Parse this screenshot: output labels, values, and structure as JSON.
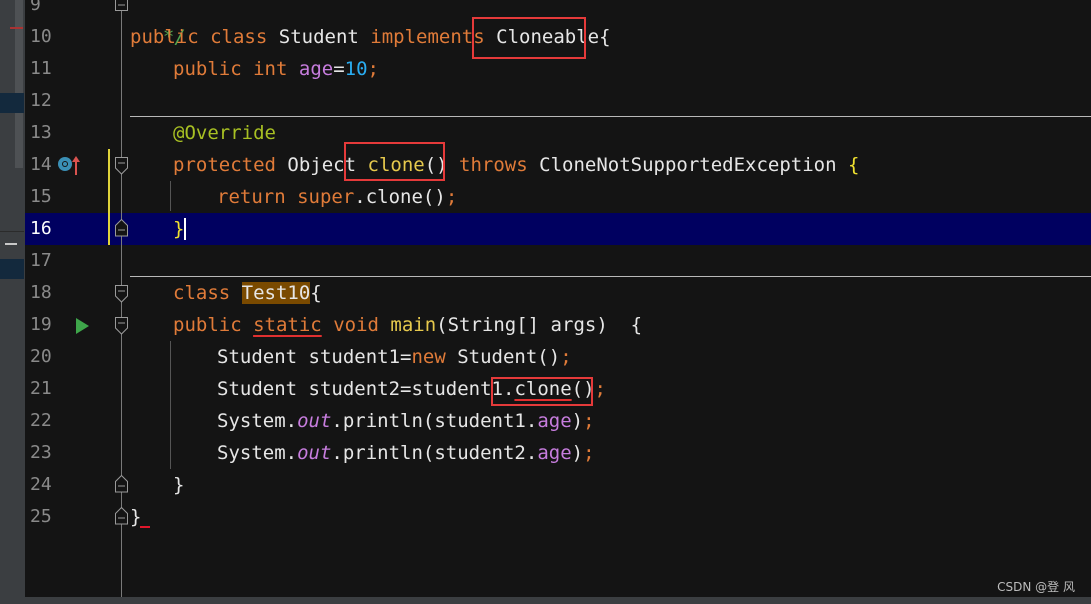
{
  "editor": {
    "language": "Java",
    "current_line": 16,
    "lines": [
      {
        "num": "9"
      },
      {
        "num": "10"
      },
      {
        "num": "11"
      },
      {
        "num": "12"
      },
      {
        "num": "13"
      },
      {
        "num": "14"
      },
      {
        "num": "15"
      },
      {
        "num": "16"
      },
      {
        "num": "17"
      },
      {
        "num": "18"
      },
      {
        "num": "19"
      },
      {
        "num": "20"
      },
      {
        "num": "21"
      },
      {
        "num": "22"
      },
      {
        "num": "23"
      },
      {
        "num": "24"
      },
      {
        "num": "25"
      }
    ],
    "tokens": {
      "l9_comment": "*/",
      "l10_public": "public",
      "l10_class": "class",
      "l10_name": "Student",
      "l10_implements": "implements",
      "l10_iface": "Cloneable",
      "l10_brace": "{",
      "l11_public": "public",
      "l11_int": "int",
      "l11_field": "age",
      "l11_eq": "=",
      "l11_value": "10",
      "l11_semi": ";",
      "l13_annotation": "@Override",
      "l14_protected": "protected",
      "l14_type": "Object",
      "l14_method": "clone",
      "l14_parens": "()",
      "l14_throws": "throws",
      "l14_exception": "CloneNotSupportedException",
      "l14_brace": "{",
      "l15_return": "return",
      "l15_super": "super",
      "l15_call": ".clone()",
      "l15_semi": ";",
      "l16_brace": "}",
      "l18_class": "class",
      "l18_name": "Test10",
      "l18_brace": "{",
      "l19_public": "public",
      "l19_static": "static",
      "l19_void": "void",
      "l19_main": "main",
      "l19_params": "(String[] args)  {",
      "l20_text": "Student student1=",
      "l20_new": "new",
      "l20_rest": " Student()",
      "l20_semi": ";",
      "l21_text": "Student student2=student1",
      "l21_dot": ".",
      "l21_clone": "clone",
      "l21_parens": "()",
      "l21_semi": ";",
      "l22_system": "System.",
      "l22_out": "out",
      "l22_println": ".println(student1.",
      "l22_field": "age",
      "l22_close": ")",
      "l22_semi": ";",
      "l23_system": "System.",
      "l23_out": "out",
      "l23_println": ".println(student2.",
      "l23_field": "age",
      "l23_close": ")",
      "l23_semi": ";",
      "l24_brace": "}",
      "l25_brace": "}"
    }
  },
  "gutter_icons": {
    "line14": [
      "override-icon",
      "implements-up-arrow-icon"
    ],
    "line19": [
      "run-icon"
    ]
  },
  "annotations": {
    "highlight_boxes": [
      "Cloneable",
      "clone()",
      ".clone();"
    ],
    "box_color": "#e53a3a"
  },
  "colors": {
    "background": "#141414",
    "current_line": "#000060",
    "keyword": "#e07b39",
    "method": "#ffc66d",
    "field": "#c77dde",
    "number": "#2aacf0",
    "annotation": "#a8c023",
    "comment": "#4fa44f"
  },
  "watermark": "CSDN @登 风"
}
